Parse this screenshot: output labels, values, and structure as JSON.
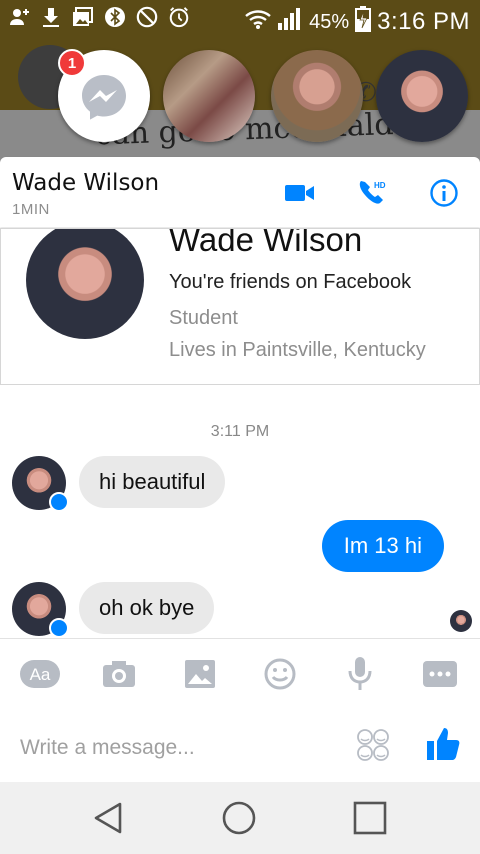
{
  "status_bar": {
    "battery": "45%",
    "time": "3:16 PM"
  },
  "chat_heads": {
    "badge_count": "1",
    "background_text": "can go to mcdonalds"
  },
  "header": {
    "name": "Wade Wilson",
    "subtitle": "1MIN",
    "hd_label": "HD"
  },
  "profile": {
    "name": "Wade Wilson",
    "friends": "You're friends on Facebook",
    "occupation": "Student",
    "location": "Lives in Paintsville, Kentucky"
  },
  "conversation": {
    "timestamp": "3:11 PM",
    "messages": [
      {
        "from": "Wade Wilson",
        "text": "hi beautiful"
      },
      {
        "from": "me",
        "text": "Im 13 hi"
      },
      {
        "from": "Wade Wilson",
        "text": "oh ok bye"
      }
    ]
  },
  "toolbar": {
    "text_label": "Aa"
  },
  "compose": {
    "placeholder": "Write a message..."
  },
  "colors": {
    "accent": "#0084ff",
    "incoming_bubble": "#e9e9e9",
    "badge": "#f03a3a"
  }
}
